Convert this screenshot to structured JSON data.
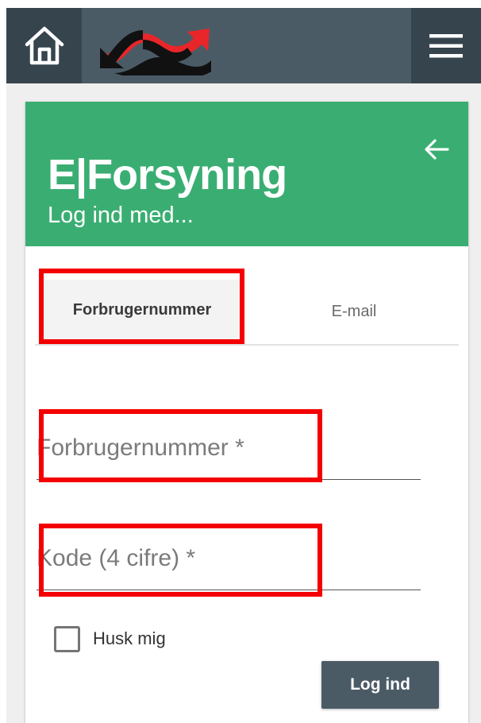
{
  "topbar": {
    "home_icon": "home-icon",
    "logo_icon": "brand-logo-icon",
    "menu_icon": "hamburger-menu-icon"
  },
  "card": {
    "title": "E|Forsyning",
    "subtitle": "Log ind med...",
    "back_icon": "arrow-left-icon"
  },
  "tabs": [
    {
      "label": "Forbrugernummer",
      "active": true
    },
    {
      "label": "E-mail",
      "active": false
    }
  ],
  "form": {
    "customer_number": {
      "placeholder": "Forbrugernummer *",
      "value": ""
    },
    "pin_code": {
      "placeholder": "Kode (4 cifre) *",
      "value": ""
    },
    "remember": {
      "label": "Husk mig",
      "checked": false
    },
    "submit_label": "Log ind"
  },
  "colors": {
    "topbar": "#4b5b66",
    "topbar_dark": "#36444e",
    "header_green": "#3aae72",
    "highlight_red": "#f40000",
    "logo_red": "#e8262a",
    "logo_black": "#111111"
  }
}
